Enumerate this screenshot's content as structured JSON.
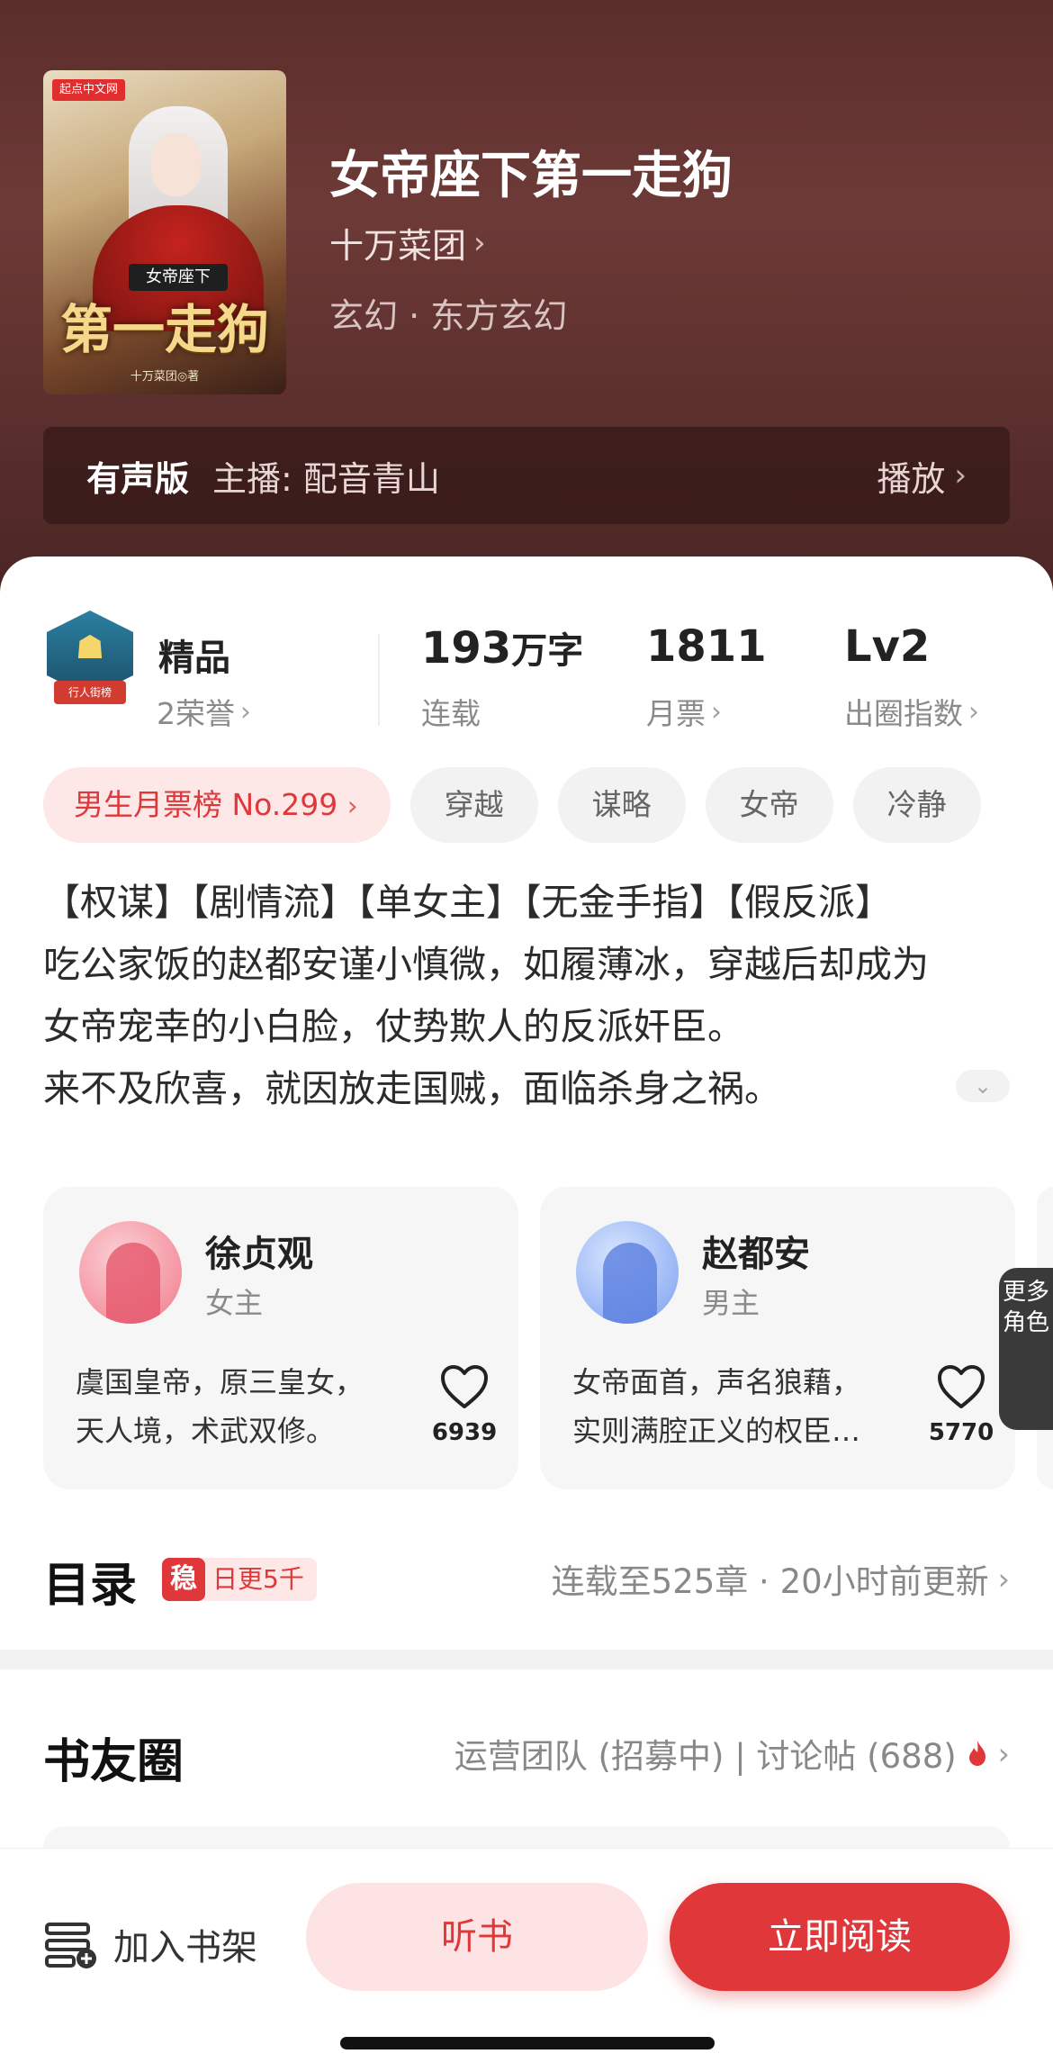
{
  "book": {
    "title": "女帝座下第一走狗",
    "author": "十万菜团",
    "genre": "玄幻 · 东方玄幻",
    "cover": {
      "logo": "起点中文网",
      "title": "第一走狗",
      "subtitle": "女帝座下",
      "author": "十万菜团◎著"
    }
  },
  "audio": {
    "label": "有声版",
    "host": "主播: 配音青山",
    "play": "播放"
  },
  "stats": {
    "badge_ribbon": "行人街榜",
    "quality_title": "精品",
    "quality_sub": "2荣誉",
    "words_num": "193",
    "words_unit": "万字",
    "words_sub": "连载",
    "tickets_num": "1811",
    "tickets_sub": "月票",
    "level_num": "Lv2",
    "level_sub": "出圈指数"
  },
  "tags": {
    "rank": "男生月票榜 No.299",
    "t1": "穿越",
    "t2": "谋略",
    "t3": "女帝",
    "t4": "冷静"
  },
  "description": {
    "line1": "【权谋】【剧情流】【单女主】【无金手指】【假反派】",
    "line2": "吃公家饭的赵都安谨小慎微，如履薄冰，穿越后却成为",
    "line3": "女帝宠幸的小白脸，仗势欺人的反派奸臣。",
    "line4": "来不及欣喜，就因放走国贼，面临杀身之祸。"
  },
  "roles": [
    {
      "name": "徐贞观",
      "type": "女主",
      "desc1": "虞国皇帝，原三皇女，",
      "desc2": "天人境，术武双修。",
      "likes": "6939"
    },
    {
      "name": "赵都安",
      "type": "男主",
      "desc1": "女帝面首，声名狼藉，",
      "desc2": "实则满腔正义的权臣…",
      "likes": "5770"
    }
  ],
  "more_roles": "更多角色",
  "catalog": {
    "title": "目录",
    "badge_icon": "稳",
    "badge_text": "日更5千",
    "status": "连载至525章 · 20小时前更新"
  },
  "circle": {
    "title": "书友圈",
    "info": "运营团队 (招募中) | 讨论帖 (688)"
  },
  "bottom": {
    "shelf": "加入书架",
    "listen": "听书",
    "read": "立即阅读"
  },
  "colors": {
    "accent": "#e0383a",
    "header_bg": "#5a2d2b",
    "tag_bg": "#f2f2f2"
  }
}
